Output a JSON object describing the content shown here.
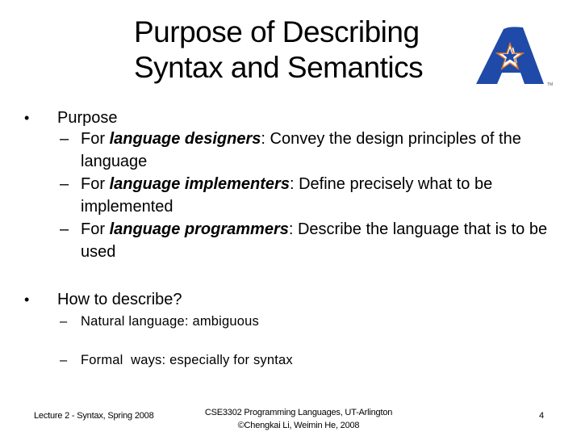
{
  "slide": {
    "title_line1": "Purpose of Describing",
    "title_line2": "Syntax and Semantics",
    "logo": {
      "icon": "uta-a-star-logo-icon",
      "primary_color": "#1f4aa8",
      "accent_color": "#e07a2a",
      "tm": "TM"
    },
    "bullets": [
      {
        "bullet_glyph": "•",
        "text": "Purpose",
        "sub": [
          {
            "dash": "–",
            "prefix": "For ",
            "emph": "language designers",
            "rest": ": Convey the design principles of the language"
          },
          {
            "dash": "–",
            "prefix": "For ",
            "emph": "language implementers",
            "rest": ": Define precisely what to be implemented"
          },
          {
            "dash": "–",
            "prefix": "For ",
            "emph": "language programmers",
            "rest": ": Describe the language that is to be used"
          }
        ]
      },
      {
        "bullet_glyph": "•",
        "text": "How to describe?",
        "sub": [
          {
            "dash": "–",
            "text": "Natural language: ambiguous"
          },
          {
            "dash": "–",
            "text": "Formal  ways: especially for syntax"
          }
        ]
      }
    ],
    "footer": {
      "left": "Lecture 2 - Syntax, Spring 2008",
      "center_line1": "CSE3302 Programming Languages, UT-Arlington",
      "center_line2": "©Chengkai Li, Weimin He, 2008",
      "page_number": "4"
    }
  }
}
